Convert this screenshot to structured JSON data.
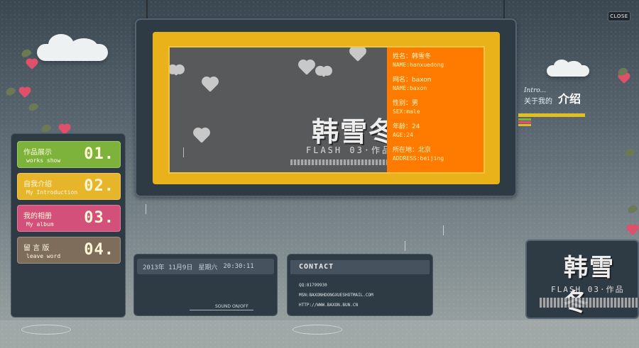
{
  "close_label": "CLOSE",
  "main": {
    "name_title": "韩雪冬",
    "subtitle": "FLASH 03·作品",
    "info": [
      {
        "label": "姓名：韩雪冬",
        "value": "NAME:hanxuedong"
      },
      {
        "label": "网名：baxon",
        "value": "NAME:baxon"
      },
      {
        "label": "性别：男",
        "value": "SEX:male"
      },
      {
        "label": "年龄：24",
        "value": "AGE:24"
      },
      {
        "label": "所在地：北京",
        "value": "ADDRESS:beijing"
      }
    ]
  },
  "menu": [
    {
      "cn": "作品展示",
      "en": "works show",
      "num": "01.",
      "color": "#7db33a"
    },
    {
      "cn": "自我介绍",
      "en": "My Introduction",
      "num": "02.",
      "color": "#e7b52a"
    },
    {
      "cn": "我的相册",
      "en": "My album",
      "num": "03.",
      "color": "#d2507a"
    },
    {
      "cn": "留 言 版",
      "en": "leave word",
      "num": "04.",
      "color": "#7d6d5a"
    }
  ],
  "date_panel": {
    "date": "2013年 11月9日",
    "weekday": "星期六",
    "time": "20:30:11",
    "sound_label": "SOUND ON/OFF"
  },
  "contact": {
    "title": "CONTACT",
    "lines": [
      "QQ:81799930",
      "MSN:BAXONHDONGXUESHOTMAIL.COM",
      "HTTP://WWW.BAXON.BUN.CN"
    ]
  },
  "intro": {
    "en": "Intro...",
    "cn_small": "关于我的",
    "cn_big": "介绍"
  },
  "preview": {
    "name_title": "韩雪冬",
    "subtitle": "FLASH 03·作品"
  }
}
